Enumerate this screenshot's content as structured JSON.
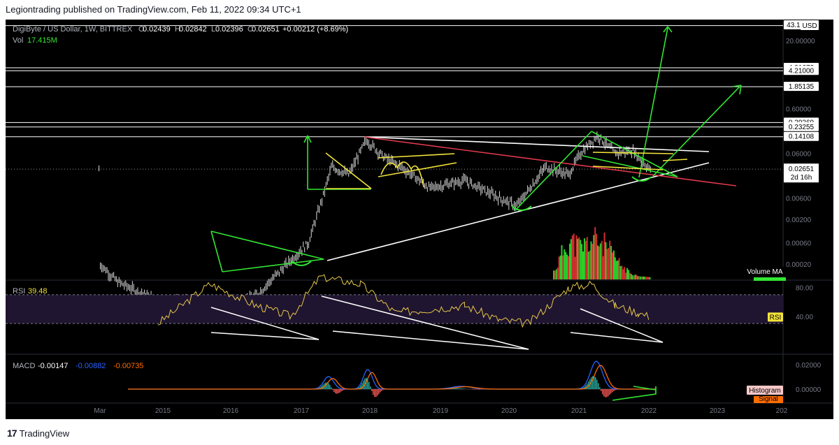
{
  "header": {
    "publisher_text": "Legiontrading published on TradingView.com, Feb 11, 2022 09:34 UTC+1"
  },
  "footer": {
    "brand": "TradingView",
    "logo_glyph": "17"
  },
  "colors": {
    "background": "#000000",
    "candle": "#d9d9d9",
    "green": "#33e633",
    "yellow": "#f2e33a",
    "red": "#e0394b",
    "white": "#ffffff",
    "rsi_line": "#e6c74a",
    "rsi_band": "#1f1530",
    "macd_line": "#2962ff",
    "signal_line": "#ff6d00",
    "volume_up": "#2bd12b",
    "volume_down": "#d32f2f"
  },
  "legend": {
    "symbol": "DigiByte / US Dollar, 1W, BITTREX",
    "ohlc": [
      {
        "key": "O",
        "value": "0.02439"
      },
      {
        "key": "H",
        "value": "0.02842"
      },
      {
        "key": "L",
        "value": "0.02396"
      },
      {
        "key": "C",
        "value": "0.02651"
      }
    ],
    "change": "+0.00212 (+8.69%)",
    "vol_label": "Vol",
    "vol_value": "17.415M"
  },
  "price_axis": {
    "currency": "USD",
    "ticks": [
      "20.00000",
      "0.60000",
      "0.06000",
      "0.00600",
      "0.00200",
      "0.00060",
      "0.00020"
    ],
    "level_labels": [
      "43.13000",
      "4.91673",
      "4.21000",
      "1.85135",
      "0.29269",
      "0.23255",
      "0.14108"
    ],
    "current_price": "0.02651",
    "countdown": "2d 16h",
    "volume_ma_label": "Volume MA"
  },
  "time_axis": {
    "labels": [
      "Mar",
      "2015",
      "2016",
      "2017",
      "2018",
      "2019",
      "2020",
      "2021",
      "2022",
      "2023",
      "202"
    ]
  },
  "rsi": {
    "title": "RSI",
    "value": "39.48",
    "ticks": [
      "80.00",
      "40.00"
    ],
    "badge": "RSI",
    "upper": 70,
    "lower": 30
  },
  "macd": {
    "title": "MACD",
    "values": [
      "-0.00147",
      "-0.00882",
      "-0.00735"
    ],
    "ticks": [
      "0.02000",
      "0.00000"
    ],
    "histogram_badge": "Histogram",
    "signal_badge": "Signal"
  },
  "chart_data": {
    "type": "line",
    "title": "DigiByte / US Dollar, 1W, BITTREX",
    "x_range": [
      "2014-03",
      "2024-01"
    ],
    "y_scale": "log",
    "horizontal_levels": [
      43.13,
      4.91673,
      4.21,
      1.85135,
      0.29269,
      0.23255,
      0.14108,
      0.02651
    ],
    "series": [
      {
        "name": "Price (approx. weekly close)",
        "x": [
          "2014-03",
          "2014-06",
          "2015-01",
          "2015-06",
          "2016-01",
          "2016-06",
          "2016-12",
          "2017-03",
          "2017-05",
          "2017-07",
          "2017-10",
          "2018-01",
          "2018-04",
          "2018-07",
          "2018-12",
          "2019-06",
          "2019-12",
          "2020-03",
          "2020-08",
          "2020-12",
          "2021-02",
          "2021-05",
          "2021-08",
          "2021-11",
          "2022-02"
        ],
        "values": [
          0.0002,
          8e-05,
          3e-05,
          3e-05,
          2e-05,
          4e-05,
          0.00025,
          0.0006,
          0.004,
          0.03,
          0.02,
          0.12,
          0.05,
          0.03,
          0.01,
          0.015,
          0.006,
          0.004,
          0.03,
          0.02,
          0.06,
          0.15,
          0.06,
          0.07,
          0.02651
        ]
      }
    ],
    "rsi_series": {
      "x": [
        "2015-01",
        "2015-10",
        "2016-06",
        "2016-12",
        "2017-05",
        "2017-12",
        "2018-06",
        "2019-06",
        "2019-12",
        "2020-05",
        "2020-12",
        "2021-04",
        "2021-08",
        "2021-12",
        "2022-02"
      ],
      "values": [
        30,
        85,
        55,
        40,
        95,
        85,
        45,
        55,
        35,
        30,
        80,
        85,
        55,
        45,
        39.48
      ]
    },
    "macd_readout": {
      "macd": -0.00147,
      "signal": -0.00882,
      "histogram": -0.00735
    }
  }
}
